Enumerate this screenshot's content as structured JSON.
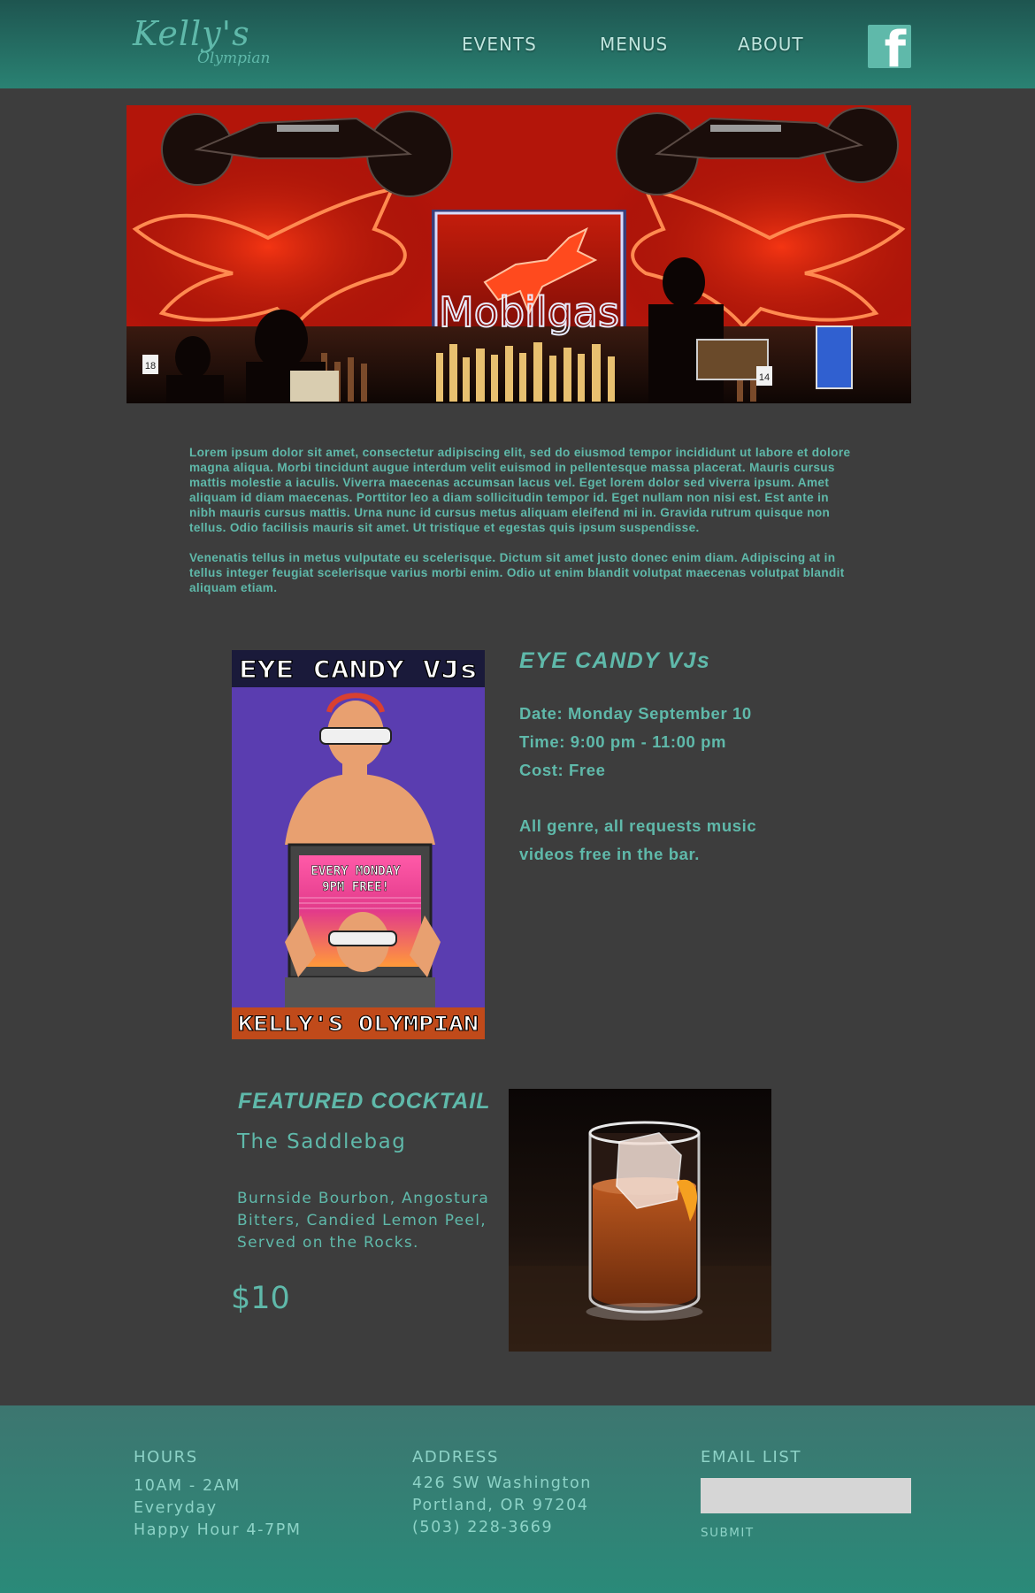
{
  "brand": {
    "name": "Kelly's",
    "subname": "Olympian"
  },
  "nav": {
    "events": "EVENTS",
    "menus": "MENUS",
    "about": "ABOUT"
  },
  "hero": {
    "sign_text": "Mobilgas",
    "table_numbers": [
      "18",
      "14"
    ]
  },
  "intro": {
    "p1": "Lorem ipsum dolor sit amet, consectetur adipiscing elit, sed do eiusmod tempor incididunt ut labore et dolore magna aliqua. Morbi tincidunt augue interdum velit euismod in pellentesque massa placerat. Mauris cursus mattis molestie a iaculis. Viverra maecenas accumsan lacus vel. Eget lorem dolor sed viverra ipsum. Amet aliquam id diam maecenas. Porttitor leo a diam sollicitudin tempor id. Eget nullam non nisi est. Est ante in nibh mauris cursus mattis. Urna nunc id cursus metus aliquam eleifend mi in. Gravida rutrum quisque non tellus. Odio facilisis mauris sit amet. Ut tristique et egestas quis ipsum suspendisse.",
    "p2": "Venenatis tellus in metus vulputate eu scelerisque. Dictum sit amet justo donec enim diam. Adipiscing at in tellus integer feugiat scelerisque varius morbi enim. Odio ut enim blandit volutpat maecenas volutpat blandit aliquam etiam."
  },
  "event": {
    "poster": {
      "top": "EYE CANDY VJs",
      "screen_line1": "EVERY MONDAY",
      "screen_line2": "9PM FREE!",
      "bottom": "KELLY'S OLYMPIAN"
    },
    "title": "EYE CANDY VJs",
    "date": "Date: Monday September 10",
    "time": "Time: 9:00 pm - 11:00 pm",
    "cost": "Cost: Free",
    "description": "All genre, all requests music videos free in the bar."
  },
  "cocktail": {
    "heading": "FEATURED COCKTAIL",
    "name": "The Saddlebag",
    "description": "Burnside Bourbon, Angostura Bitters, Candied Lemon Peel, Served on the Rocks.",
    "price": "$10"
  },
  "footer": {
    "hours": {
      "heading": "HOURS",
      "line1": "10AM - 2AM",
      "line2": "Everyday",
      "line3": "Happy Hour 4-7PM"
    },
    "address": {
      "heading": "ADDRESS",
      "line1": "426 SW Washington",
      "line2": "Portland, OR 97204",
      "line3": "(503) 228-3669"
    },
    "email": {
      "heading": "EMAIL LIST",
      "value": "",
      "placeholder": "",
      "submit": "SUBMIT"
    }
  },
  "colors": {
    "accent": "#5fb9aa",
    "background": "#3d3d3d",
    "header_dark": "#1e5550",
    "header_light": "#2a8273",
    "footer": "#2a8a79",
    "neon": "#ff2a10"
  }
}
